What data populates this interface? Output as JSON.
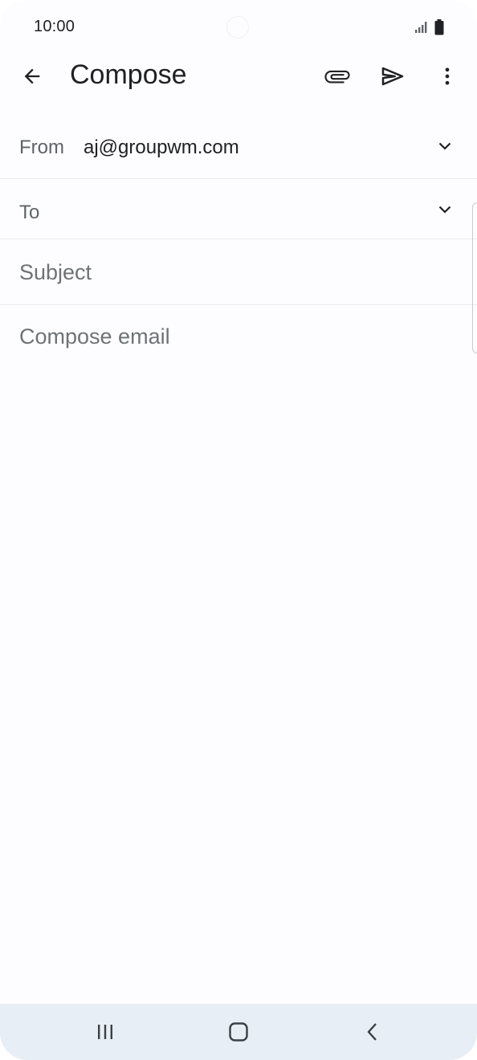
{
  "status_bar": {
    "time": "10:00",
    "signal_icon": "signal-icon",
    "battery_icon": "battery-icon"
  },
  "app_bar": {
    "title": "Compose",
    "back_icon": "arrow-back-icon",
    "attach_icon": "paperclip-icon",
    "send_icon": "send-icon",
    "more_icon": "more-vert-icon"
  },
  "from": {
    "label": "From",
    "value": "aj@groupwm.com"
  },
  "to": {
    "label": "To"
  },
  "subject": {
    "placeholder": "Subject",
    "value": ""
  },
  "body": {
    "placeholder": "Compose email",
    "value": ""
  },
  "nav_bar": {
    "recents_icon": "recents-icon",
    "home_icon": "home-icon",
    "back_icon": "nav-back-icon"
  },
  "colors": {
    "background": "#fdfdff",
    "nav_background": "#e7eef6",
    "text_primary": "#202124",
    "text_secondary": "#5f6368"
  }
}
